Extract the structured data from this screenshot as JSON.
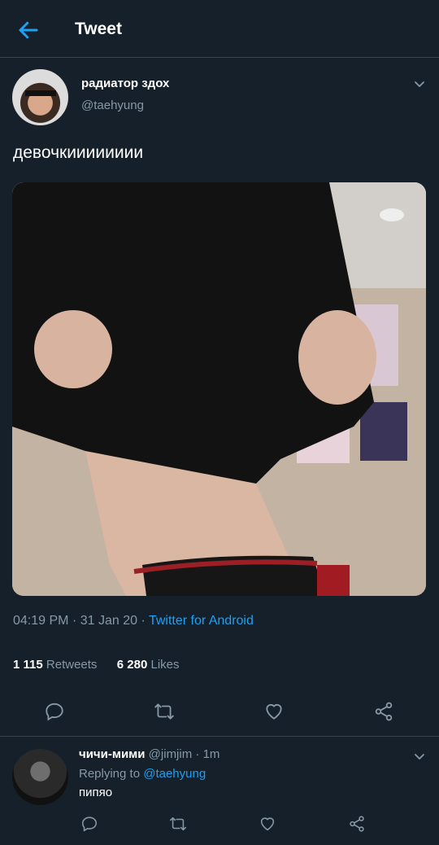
{
  "header": {
    "title": "Tweet",
    "back_icon": "arrow-left-icon",
    "accent": "#1da1f2"
  },
  "tweet": {
    "author_name": "радиатор здох",
    "author_handle": "@taehyung",
    "text": "девочкииииииии",
    "time": "04:19 PM",
    "date": "31 Jan 20",
    "source": "Twitter for Android",
    "retweets_count": "1 115",
    "retweets_label": "Retweets",
    "likes_count": "6 280",
    "likes_label": "Likes"
  },
  "reply": {
    "name": "чичи-мими",
    "handle": "@jimjim",
    "time": "1m",
    "replying_prefix": "Replying to",
    "replying_handle": "@taehyung",
    "text": "пипяо"
  },
  "colors": {
    "background": "#15202b",
    "divider": "#38444d",
    "secondary_text": "#8899a6",
    "link": "#1da1f2"
  }
}
